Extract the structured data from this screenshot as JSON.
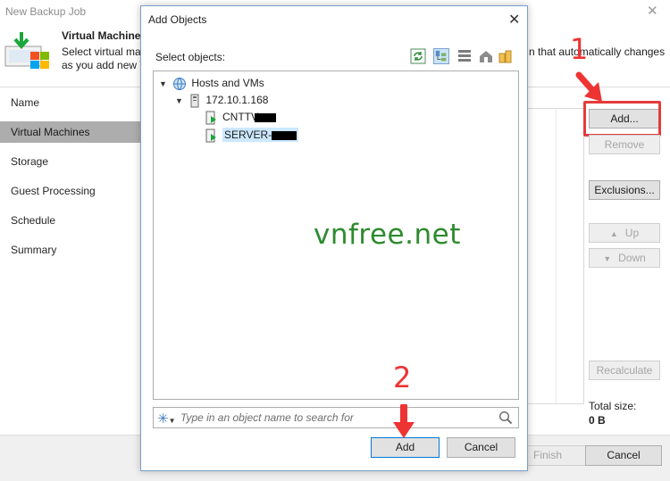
{
  "wizard": {
    "title": "New Backup Job",
    "heading": "Virtual Machines",
    "desc_line1": "Select virtual ma",
    "desc_line2": "as you add new V",
    "desc_right": "n that automatically changes",
    "nav": [
      "Name",
      "Virtual Machines",
      "Storage",
      "Guest Processing",
      "Schedule",
      "Summary"
    ],
    "active_nav": "Virtual Machines",
    "buttons": {
      "add": "Add...",
      "remove": "Remove",
      "exclusions": "Exclusions...",
      "up": "Up",
      "down": "Down",
      "recalculate": "Recalculate",
      "finish": "Finish",
      "cancel": "Cancel"
    },
    "total_size_label": "Total size:",
    "total_size_value": "0 B"
  },
  "dialog": {
    "title": "Add Objects",
    "select_label": "Select objects:",
    "tree": {
      "root": "Hosts and VMs",
      "host": "172.10.1.168",
      "vms": [
        "CNTTV",
        "SERVER-"
      ]
    },
    "search_placeholder": "Type in an object name to search for",
    "add_button": "Add",
    "cancel_button": "Cancel"
  },
  "watermark": "vnfree.net",
  "annotations": {
    "step1": "1",
    "step2": "2"
  },
  "colors": {
    "accent": "#e53b3b",
    "selection": "#cce8ff",
    "nav_active": "#adadad",
    "watermark": "#2e8b2e"
  }
}
